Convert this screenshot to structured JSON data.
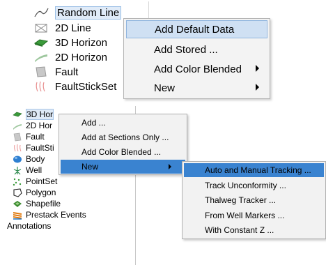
{
  "top_tree": {
    "items": [
      {
        "label": "Random Line",
        "icon": "random-line-icon"
      },
      {
        "label": "2D Line",
        "icon": "2d-line-icon"
      },
      {
        "label": "3D Horizon",
        "icon": "3d-horizon-icon"
      },
      {
        "label": "2D Horizon",
        "icon": "2d-horizon-icon"
      },
      {
        "label": "Fault",
        "icon": "fault-icon"
      },
      {
        "label": "FaultStickSet",
        "icon": "faultstickset-icon"
      }
    ]
  },
  "top_menu": {
    "items": [
      {
        "label": "Add Default Data",
        "highlighted": true
      },
      {
        "label": "Add Stored ..."
      },
      {
        "label": "Add Color Blended",
        "submenu": true
      },
      {
        "label": "New",
        "submenu": true
      }
    ]
  },
  "bottom_tree": {
    "items": [
      {
        "label": "3D Hor",
        "icon": "3d-horizon-icon"
      },
      {
        "label": "2D Hor",
        "icon": "2d-horizon-icon"
      },
      {
        "label": "Fault",
        "icon": "fault-icon"
      },
      {
        "label": "FaultSti",
        "icon": "faultstickset-icon"
      },
      {
        "label": "Body",
        "icon": "body-icon"
      },
      {
        "label": "Well",
        "icon": "well-icon"
      },
      {
        "label": "PointSet",
        "icon": "pointset-icon"
      },
      {
        "label": "Polygon",
        "icon": "polygon-icon"
      },
      {
        "label": "Shapefile",
        "icon": "shapefile-icon"
      },
      {
        "label": "Prestack Events",
        "icon": "prestack-events-icon"
      },
      {
        "label": "Annotations",
        "icon": ""
      }
    ]
  },
  "context_menu": {
    "items": [
      {
        "label": "Add ..."
      },
      {
        "label": "Add at Sections Only ..."
      },
      {
        "label": "Add Color Blended ..."
      },
      {
        "label": "New",
        "submenu": true,
        "highlighted": true
      }
    ]
  },
  "new_submenu": {
    "items": [
      {
        "label": "Auto and Manual Tracking ...",
        "highlighted": true
      },
      {
        "label": "Track Unconformity ..."
      },
      {
        "label": "Thalweg Tracker ..."
      },
      {
        "label": "From Well Markers ..."
      },
      {
        "label": "With Constant Z ..."
      }
    ]
  },
  "colors": {
    "menu_highlight": "#3a83d0",
    "top_menu_highlight": "#cfe0f3",
    "selection": "#e0ebf8"
  }
}
